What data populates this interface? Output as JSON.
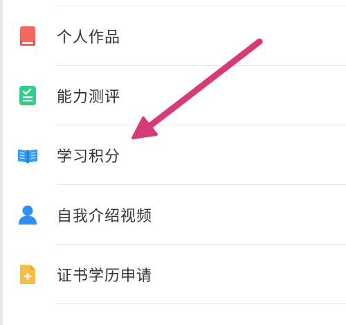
{
  "menu": {
    "items": [
      {
        "label": "个人作品",
        "icon": "red-book-icon",
        "color": "#f2675f"
      },
      {
        "label": "能力测评",
        "icon": "green-checklist-icon",
        "color": "#33cc88"
      },
      {
        "label": "学习积分",
        "icon": "blue-open-book-icon",
        "color": "#2f9cf5"
      },
      {
        "label": "自我介绍视频",
        "icon": "blue-person-icon",
        "color": "#2f8ff5"
      },
      {
        "label": "证书学历申请",
        "icon": "yellow-document-plus-icon",
        "color": "#f7bf4a"
      }
    ]
  },
  "annotation": {
    "icon": "pointer-arrow-icon",
    "color": "#d63a78"
  }
}
